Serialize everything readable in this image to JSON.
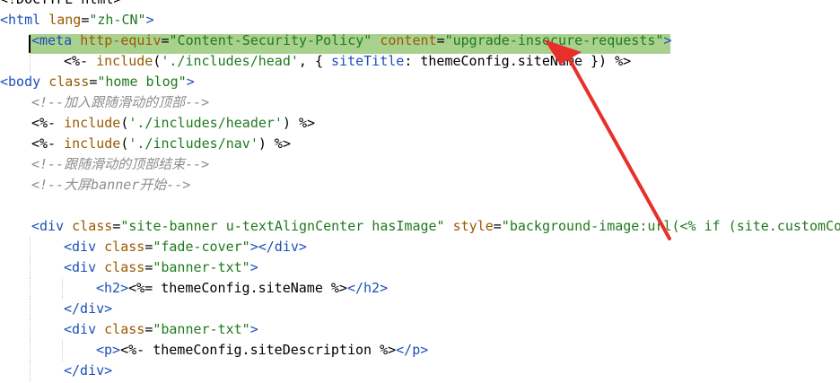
{
  "editor": {
    "lines": [
      {
        "indent": 0,
        "tokens": [
          {
            "t": "txt",
            "v": "<!DOCTYPE html>"
          }
        ]
      },
      {
        "indent": 0,
        "tokens": [
          {
            "t": "tag",
            "v": "<html"
          },
          {
            "t": "txt",
            "v": " "
          },
          {
            "t": "attr",
            "v": "lang"
          },
          {
            "t": "txt",
            "v": "="
          },
          {
            "t": "str",
            "v": "\"zh-CN\""
          },
          {
            "t": "tag",
            "v": ">"
          }
        ]
      },
      {
        "indent": 1,
        "tokens": [
          {
            "t": "tag",
            "v": "<meta"
          },
          {
            "t": "txt",
            "v": " "
          },
          {
            "t": "attr",
            "v": "http-equiv"
          },
          {
            "t": "txt",
            "v": "="
          },
          {
            "t": "str",
            "v": "\"Content-Security-Policy\""
          },
          {
            "t": "txt",
            "v": " "
          },
          {
            "t": "attr",
            "v": "content"
          },
          {
            "t": "txt",
            "v": "="
          },
          {
            "t": "str",
            "v": "\"upgrade-insecure-requests\""
          },
          {
            "t": "tag",
            "v": ">"
          }
        ]
      },
      {
        "indent": 2,
        "tokens": [
          {
            "t": "txt",
            "v": "<%- "
          },
          {
            "t": "attr",
            "v": "include"
          },
          {
            "t": "txt",
            "v": "("
          },
          {
            "t": "str",
            "v": "'./includes/head'"
          },
          {
            "t": "txt",
            "v": ", { "
          },
          {
            "t": "tag",
            "v": "siteTitle"
          },
          {
            "t": "txt",
            "v": ": themeConfig.siteName }) %>"
          }
        ]
      },
      {
        "indent": 0,
        "tokens": [
          {
            "t": "tag",
            "v": "<body"
          },
          {
            "t": "txt",
            "v": " "
          },
          {
            "t": "attr",
            "v": "class"
          },
          {
            "t": "txt",
            "v": "="
          },
          {
            "t": "str",
            "v": "\"home blog\""
          },
          {
            "t": "tag",
            "v": ">"
          }
        ]
      },
      {
        "indent": 1,
        "tokens": [
          {
            "t": "com",
            "v": "<!--加入跟随滑动的顶部-->"
          }
        ]
      },
      {
        "indent": 1,
        "tokens": [
          {
            "t": "txt",
            "v": "<%- "
          },
          {
            "t": "attr",
            "v": "include"
          },
          {
            "t": "txt",
            "v": "("
          },
          {
            "t": "str",
            "v": "'./includes/header'"
          },
          {
            "t": "txt",
            "v": ") %>"
          }
        ]
      },
      {
        "indent": 1,
        "tokens": [
          {
            "t": "txt",
            "v": "<%- "
          },
          {
            "t": "attr",
            "v": "include"
          },
          {
            "t": "txt",
            "v": "("
          },
          {
            "t": "str",
            "v": "'./includes/nav'"
          },
          {
            "t": "txt",
            "v": ") %>"
          }
        ]
      },
      {
        "indent": 1,
        "tokens": [
          {
            "t": "com",
            "v": "<!--跟随滑动的顶部结束-->"
          }
        ]
      },
      {
        "indent": 1,
        "tokens": [
          {
            "t": "com",
            "v": "<!--大屏banner开始-->"
          }
        ]
      },
      {
        "indent": 0,
        "tokens": []
      },
      {
        "indent": 1,
        "tokens": [
          {
            "t": "tag",
            "v": "<div"
          },
          {
            "t": "txt",
            "v": " "
          },
          {
            "t": "attr",
            "v": "class"
          },
          {
            "t": "txt",
            "v": "="
          },
          {
            "t": "str",
            "v": "\"site-banner u-textAlignCenter hasImage\""
          },
          {
            "t": "txt",
            "v": " "
          },
          {
            "t": "attr",
            "v": "style"
          },
          {
            "t": "txt",
            "v": "="
          },
          {
            "t": "str",
            "v": "\"background-image:url(<% if (site.customConfig"
          }
        ]
      },
      {
        "indent": 2,
        "tokens": [
          {
            "t": "tag",
            "v": "<div"
          },
          {
            "t": "txt",
            "v": " "
          },
          {
            "t": "attr",
            "v": "class"
          },
          {
            "t": "txt",
            "v": "="
          },
          {
            "t": "str",
            "v": "\"fade-cover\""
          },
          {
            "t": "tag",
            "v": "></div>"
          }
        ]
      },
      {
        "indent": 2,
        "tokens": [
          {
            "t": "tag",
            "v": "<div"
          },
          {
            "t": "txt",
            "v": " "
          },
          {
            "t": "attr",
            "v": "class"
          },
          {
            "t": "txt",
            "v": "="
          },
          {
            "t": "str",
            "v": "\"banner-txt\""
          },
          {
            "t": "tag",
            "v": ">"
          }
        ]
      },
      {
        "indent": 3,
        "tokens": [
          {
            "t": "tag",
            "v": "<h2>"
          },
          {
            "t": "txt",
            "v": "<%= themeConfig.siteName %>"
          },
          {
            "t": "tag",
            "v": "</h2>"
          }
        ]
      },
      {
        "indent": 2,
        "tokens": [
          {
            "t": "tag",
            "v": "</div>"
          }
        ]
      },
      {
        "indent": 2,
        "tokens": [
          {
            "t": "tag",
            "v": "<div"
          },
          {
            "t": "txt",
            "v": " "
          },
          {
            "t": "attr",
            "v": "class"
          },
          {
            "t": "txt",
            "v": "="
          },
          {
            "t": "str",
            "v": "\"banner-txt\""
          },
          {
            "t": "tag",
            "v": ">"
          }
        ]
      },
      {
        "indent": 3,
        "tokens": [
          {
            "t": "tag",
            "v": "<p>"
          },
          {
            "t": "txt",
            "v": "<%- themeConfig.siteDescription %>"
          },
          {
            "t": "tag",
            "v": "</p>"
          }
        ]
      },
      {
        "indent": 2,
        "tokens": [
          {
            "t": "tag",
            "v": "</div>"
          }
        ]
      }
    ],
    "highlighted_line": 2
  },
  "colors": {
    "tag": "#1d4fb8",
    "attribute": "#9a5a00",
    "string": "#1f7a1f",
    "comment": "#8e8e8e",
    "text": "#000000",
    "line_highlight": "#a9d18e",
    "annotation_arrow": "#e8302a"
  },
  "annotation": {
    "icon": "red-arrow-icon"
  }
}
